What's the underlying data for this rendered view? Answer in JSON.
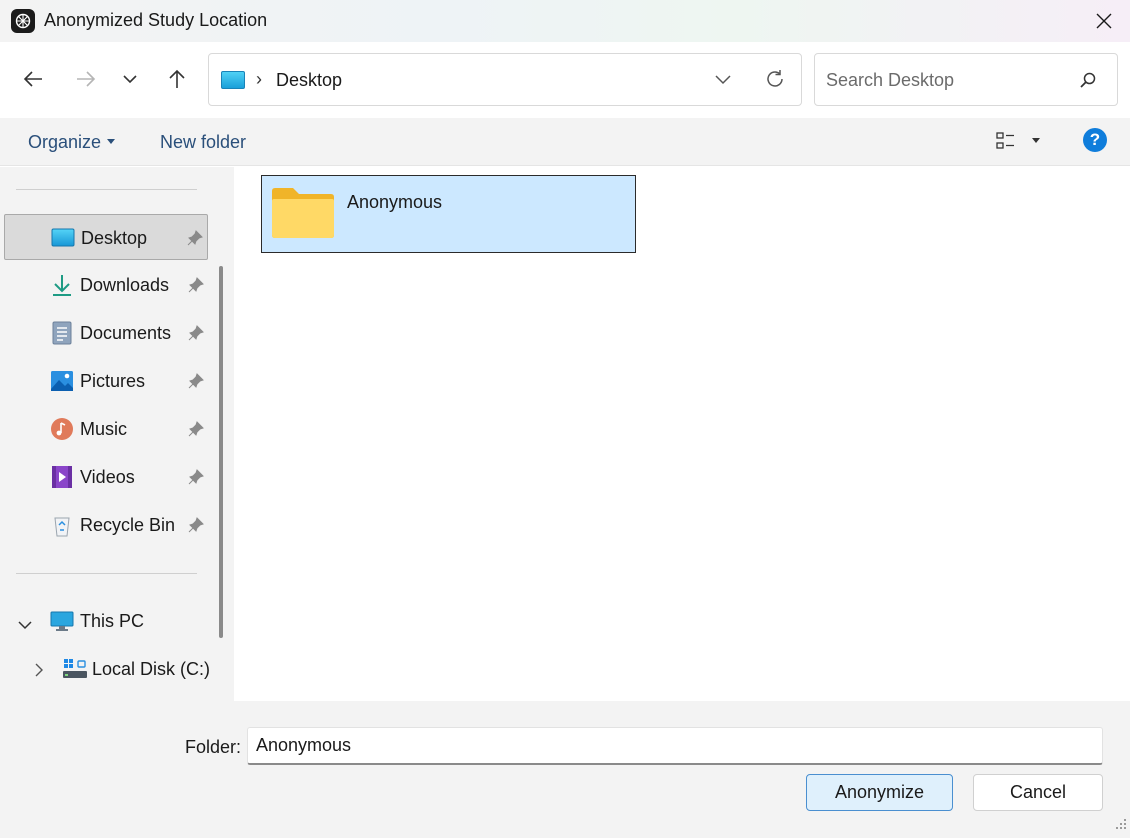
{
  "window": {
    "title": "Anonymized Study Location"
  },
  "address_bar": {
    "crumb": "Desktop",
    "separator": "›"
  },
  "search": {
    "placeholder": "Search Desktop"
  },
  "command_bar": {
    "organize_label": "Organize",
    "new_folder_label": "New folder"
  },
  "sidebar": {
    "quick_access": [
      {
        "label": "Desktop",
        "icon": "desktop-icon",
        "pinned": true,
        "selected": true
      },
      {
        "label": "Downloads",
        "icon": "downloads-icon",
        "pinned": true
      },
      {
        "label": "Documents",
        "icon": "documents-icon",
        "pinned": true
      },
      {
        "label": "Pictures",
        "icon": "pictures-icon",
        "pinned": true
      },
      {
        "label": "Music",
        "icon": "music-icon",
        "pinned": true
      },
      {
        "label": "Videos",
        "icon": "videos-icon",
        "pinned": true
      },
      {
        "label": "Recycle Bin",
        "icon": "recycle-bin-icon",
        "pinned": true
      }
    ],
    "this_pc": {
      "label": "This PC",
      "expanded": true
    },
    "local_disk": {
      "label": "Local Disk (C:)",
      "expanded": false
    }
  },
  "content": {
    "items": [
      {
        "name": "Anonymous",
        "type": "folder",
        "selected": true
      }
    ]
  },
  "footer": {
    "folder_label": "Folder:",
    "folder_value": "Anonymous",
    "primary_button": "Anonymize",
    "cancel_button": "Cancel"
  },
  "colors": {
    "accent": "#0f7ddb",
    "selection": "#cce8ff",
    "panel": "#f3f3f3"
  }
}
